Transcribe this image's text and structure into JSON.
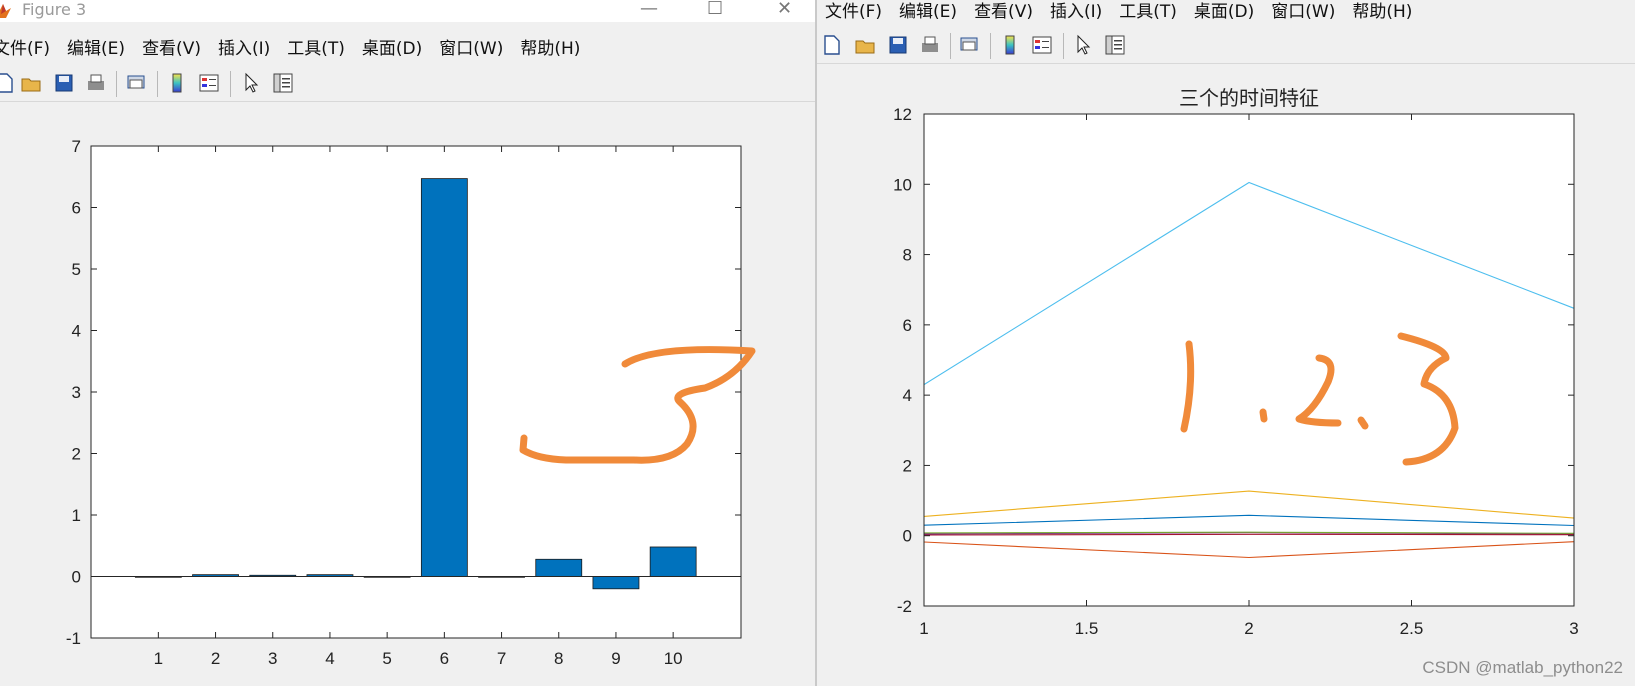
{
  "left_window": {
    "title": "Figure 3",
    "menu": [
      "文件(F)",
      "编辑(E)",
      "查看(V)",
      "插入(I)",
      "工具(T)",
      "桌面(D)",
      "窗口(W)",
      "帮助(H)"
    ],
    "controls": {
      "minimize": "—",
      "maximize": "☐",
      "close": "✕"
    }
  },
  "right_window": {
    "menu": [
      "文件(F)",
      "编辑(E)",
      "查看(V)",
      "插入(I)",
      "工具(T)",
      "桌面(D)",
      "窗口(W)",
      "帮助(H)"
    ]
  },
  "toolbar_icons": [
    "new-file-icon",
    "open-folder-icon",
    "save-icon",
    "print-icon",
    "print-preview-icon",
    "colorbar-icon",
    "legend-icon",
    "pointer-arrow-icon",
    "property-inspector-icon"
  ],
  "annotations": {
    "left_handwriting": "3",
    "right_handwriting": "1.2.3",
    "color": "#f08a3a"
  },
  "watermark": "CSDN @matlab_python22",
  "chart_data": [
    {
      "type": "bar",
      "title": "",
      "xlabel": "",
      "ylabel": "",
      "categories": [
        "1",
        "2",
        "3",
        "4",
        "5",
        "6",
        "7",
        "8",
        "9",
        "10"
      ],
      "values": [
        0.0,
        0.03,
        0.02,
        0.03,
        0.0,
        6.47,
        0.0,
        0.28,
        -0.2,
        0.48
      ],
      "ylim": [
        -1,
        7
      ],
      "yticks": [
        -1,
        0,
        1,
        2,
        3,
        4,
        5,
        6,
        7
      ],
      "bar_color": "#0072bd",
      "grid": false
    },
    {
      "type": "line",
      "title": "三个的时间特征",
      "xlabel": "",
      "ylabel": "",
      "x": [
        1,
        2,
        3
      ],
      "xlim": [
        1,
        3
      ],
      "xticks": [
        1,
        1.5,
        2,
        2.5,
        3
      ],
      "ylim": [
        -2,
        12
      ],
      "yticks": [
        -2,
        0,
        2,
        4,
        6,
        8,
        10,
        12
      ],
      "series": [
        {
          "values": [
            0.3,
            0.58,
            0.29
          ],
          "color": "#0072bd"
        },
        {
          "values": [
            -0.18,
            -0.62,
            -0.17
          ],
          "color": "#d95319"
        },
        {
          "values": [
            0.55,
            1.27,
            0.5
          ],
          "color": "#edb120"
        },
        {
          "values": [
            0.05,
            0.09,
            0.05
          ],
          "color": "#7e2f8e"
        },
        {
          "values": [
            0.08,
            0.1,
            0.07
          ],
          "color": "#77ac30"
        },
        {
          "values": [
            4.3,
            10.05,
            6.47
          ],
          "color": "#4dbeee"
        },
        {
          "values": [
            0.02,
            0.04,
            0.03
          ],
          "color": "#a2142f"
        }
      ],
      "grid": false
    }
  ]
}
